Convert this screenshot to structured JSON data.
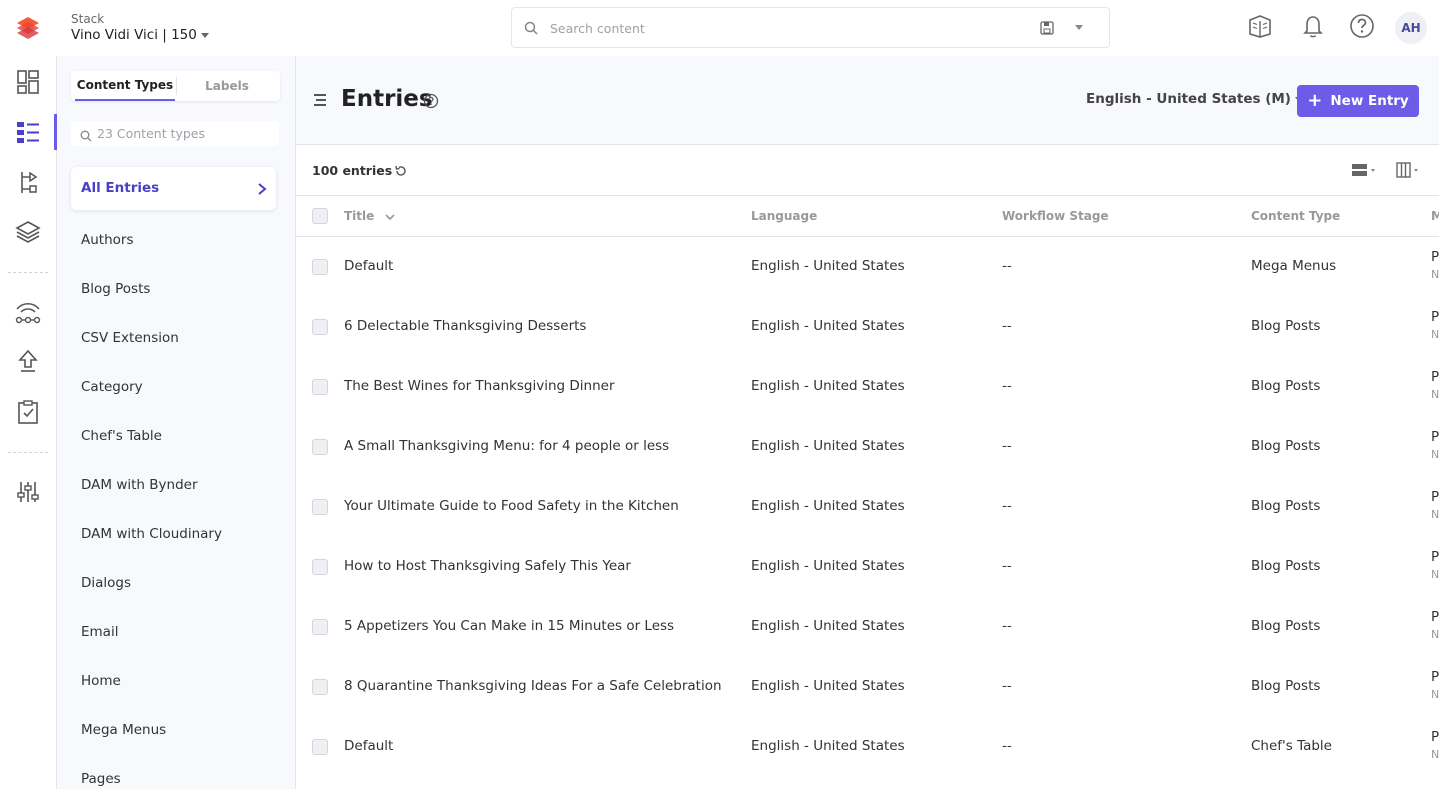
{
  "topbar": {
    "stack_label": "Stack",
    "stack_name": "Vino Vidi Vici | 150",
    "search_placeholder": "Search content",
    "avatar_initials": "AH"
  },
  "content_types": {
    "tabs": [
      "Content Types",
      "Labels"
    ],
    "search_placeholder": "23 Content types",
    "all_entries": "All Entries",
    "items": [
      "Authors",
      "Blog Posts",
      "CSV Extension",
      "Category",
      "Chef's Table",
      "DAM with Bynder",
      "DAM with Cloudinary",
      "Dialogs",
      "Email",
      "Home",
      "Mega Menus",
      "Pages"
    ]
  },
  "main": {
    "title": "Entries",
    "locale": "English - United States (M)",
    "new_entry": "New Entry",
    "entry_count": "100 entries",
    "columns": {
      "title": "Title",
      "language": "Language",
      "workflow": "Workflow Stage",
      "content_type": "Content Type",
      "modified_clip": "M"
    },
    "rows": [
      {
        "title": "Default",
        "language": "English - United States",
        "workflow": "--",
        "content_type": "Mega Menus",
        "clip1": "P",
        "clip2": "N"
      },
      {
        "title": "6 Delectable Thanksgiving Desserts",
        "language": "English - United States",
        "workflow": "--",
        "content_type": "Blog Posts",
        "clip1": "P",
        "clip2": "N"
      },
      {
        "title": "The Best Wines for Thanksgiving Dinner",
        "language": "English - United States",
        "workflow": "--",
        "content_type": "Blog Posts",
        "clip1": "P",
        "clip2": "N"
      },
      {
        "title": "A Small Thanksgiving Menu: for 4 people or less",
        "language": "English - United States",
        "workflow": "--",
        "content_type": "Blog Posts",
        "clip1": "P",
        "clip2": "N"
      },
      {
        "title": "Your Ultimate Guide to Food Safety in the Kitchen",
        "language": "English - United States",
        "workflow": "--",
        "content_type": "Blog Posts",
        "clip1": "P",
        "clip2": "N"
      },
      {
        "title": "How to Host Thanksgiving Safely This Year",
        "language": "English - United States",
        "workflow": "--",
        "content_type": "Blog Posts",
        "clip1": "P",
        "clip2": "N"
      },
      {
        "title": "5 Appetizers You Can Make in 15 Minutes or Less",
        "language": "English - United States",
        "workflow": "--",
        "content_type": "Blog Posts",
        "clip1": "P",
        "clip2": "N"
      },
      {
        "title": "8 Quarantine Thanksgiving Ideas For a Safe Celebration",
        "language": "English - United States",
        "workflow": "--",
        "content_type": "Blog Posts",
        "clip1": "P",
        "clip2": "N"
      },
      {
        "title": "Default",
        "language": "English - United States",
        "workflow": "--",
        "content_type": "Chef's Table",
        "clip1": "P",
        "clip2": "N"
      }
    ]
  },
  "colors": {
    "accent": "#6c5ce7",
    "accent_text": "#4b3fc7"
  }
}
